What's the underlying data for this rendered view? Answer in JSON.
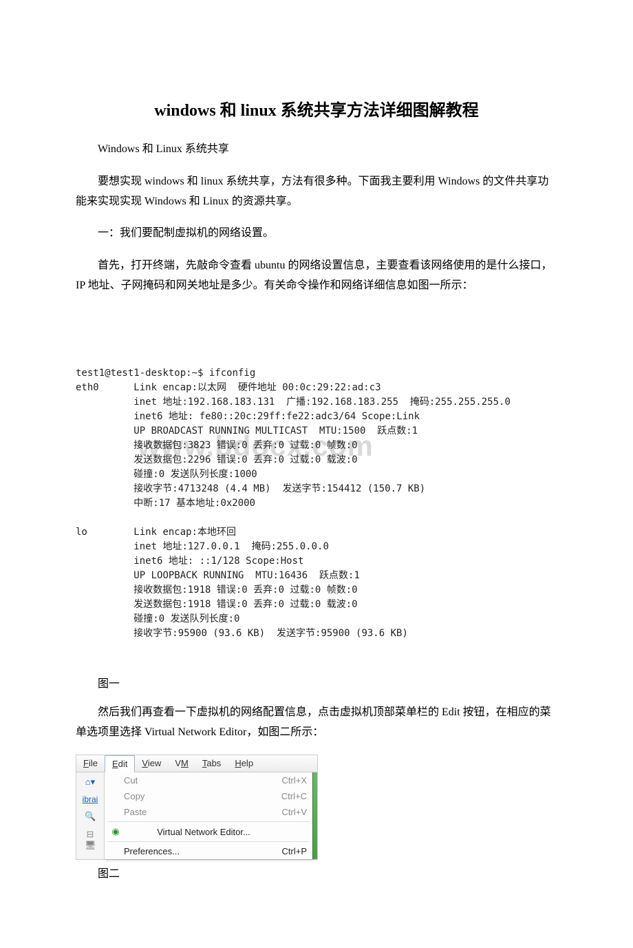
{
  "title": "windows 和 linux 系统共享方法详细图解教程",
  "intro1": "Windows 和 Linux 系统共享",
  "intro2": "要想实现 windows 和 linux 系统共享，方法有很多种。下面我主要利用 Windows 的文件共享功能来实现实现 Windows 和 Linux 的资源共享。",
  "section1": "一：我们要配制虚拟机的网络设置。",
  "para1": "首先，打开终端，先敲命令查看 ubuntu 的网络设置信息，主要查看该网络使用的是什么接口，IP 地址、子网掩码和网关地址是多少。有关命令操作和网络详细信息如图一所示：",
  "terminal": {
    "prompt": "test1@test1-desktop:~$ ifconfig",
    "eth0": {
      "name": "eth0",
      "l1": "Link encap:以太网  硬件地址 00:0c:29:22:ad:c3",
      "l2": "inet 地址:192.168.183.131  广播:192.168.183.255  掩码:255.255.255.0",
      "l3": "inet6 地址: fe80::20c:29ff:fe22:adc3/64 Scope:Link",
      "l4": "UP BROADCAST RUNNING MULTICAST  MTU:1500  跃点数:1",
      "l5": "接收数据包:3823 错误:0 丢弃:0 过载:0 帧数:0",
      "l6": "发送数据包:2296 错误:0 丢弃:0 过载:0 载波:0",
      "l7": "碰撞:0 发送队列长度:1000",
      "l8": "接收字节:4713248 (4.4 MB)  发送字节:154412 (150.7 KB)",
      "l9": "中断:17 基本地址:0x2000"
    },
    "lo": {
      "name": "lo",
      "l1": "Link encap:本地环回",
      "l2": "inet 地址:127.0.0.1  掩码:255.0.0.0",
      "l3": "inet6 地址: ::1/128 Scope:Host",
      "l4": "UP LOOPBACK RUNNING  MTU:16436  跃点数:1",
      "l5": "接收数据包:1918 错误:0 丢弃:0 过载:0 帧数:0",
      "l6": "发送数据包:1918 错误:0 丢弃:0 过载:0 载波:0",
      "l7": "碰撞:0 发送队列长度:0",
      "l8": "接收字节:95900 (93.6 KB)  发送字节:95900 (93.6 KB)"
    }
  },
  "watermark": "www.bdocx.com",
  "fig1": "图一",
  "para2": "然后我们再查看一下虚拟机的网络配置信息，点击虚拟机顶部菜单栏的 Edit 按钮，在相应的菜单选项里选择 Virtual Network Editor，如图二所示：",
  "menu": {
    "file": "File",
    "edit": "Edit",
    "view": "View",
    "vm": "VM",
    "tabs": "Tabs",
    "help": "Help",
    "cut": "Cut",
    "cut_sc": "Ctrl+X",
    "copy": "Copy",
    "copy_sc": "Ctrl+C",
    "paste": "Paste",
    "paste_sc": "Ctrl+V",
    "vne": "Virtual Network Editor...",
    "prefs": "Preferences...",
    "prefs_sc": "Ctrl+P",
    "ibra": "ibrai"
  },
  "fig2": "图二"
}
